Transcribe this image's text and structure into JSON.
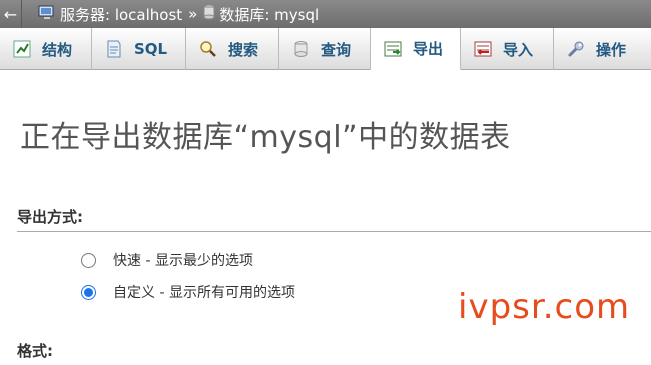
{
  "breadcrumb": {
    "back_glyph": "←",
    "server_label": "服务器: localhost",
    "separator": "»",
    "database_label": "数据库: mysql"
  },
  "tabs": [
    {
      "label": "结构",
      "icon": "structure-icon"
    },
    {
      "label": "SQL",
      "icon": "sql-icon"
    },
    {
      "label": "搜索",
      "icon": "search-icon"
    },
    {
      "label": "查询",
      "icon": "query-icon"
    },
    {
      "label": "导出",
      "icon": "export-icon",
      "active": true
    },
    {
      "label": "导入",
      "icon": "import-icon"
    },
    {
      "label": "操作",
      "icon": "wrench-icon"
    }
  ],
  "page_title": "正在导出数据库“mysql”中的数据表",
  "export_method": {
    "heading": "导出方式:",
    "options": [
      {
        "label": "快速 - 显示最少的选项",
        "checked": false
      },
      {
        "label": "自定义 - 显示所有可用的选项",
        "checked": true
      }
    ]
  },
  "format_heading": "格式:",
  "watermark": "ivpsr.com",
  "colors": {
    "accent": "#1a73e8",
    "tab_text": "#235a81",
    "watermark": "#e74c1c"
  }
}
